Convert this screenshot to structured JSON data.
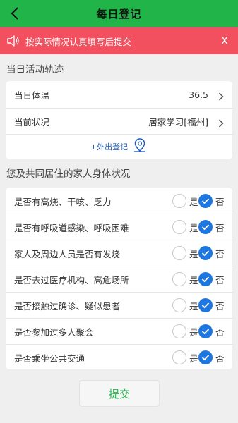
{
  "header": {
    "title": "每日登记"
  },
  "notice": {
    "text": "按实际情况认真填写后提交",
    "close": "X"
  },
  "activity": {
    "section_title": "当日活动轨迹",
    "temperature": {
      "label": "当日体温",
      "value": "36.5"
    },
    "status": {
      "label": "当前状况",
      "value": "居家学习[福州]"
    },
    "out_register": "+外出登记"
  },
  "health": {
    "section_title": "您及共同居住的家人身体状况",
    "yes_label": "是",
    "no_label": "否",
    "questions": [
      {
        "text": "是否有高烧、干咳、乏力",
        "answer": "否"
      },
      {
        "text": "是否有呼吸道感染、呼吸困难",
        "answer": "否"
      },
      {
        "text": "家人及周边人员是否有发烧",
        "answer": "否"
      },
      {
        "text": "是否去过医疗机构、高危场所",
        "answer": "否"
      },
      {
        "text": "是否接触过确诊、疑似患者",
        "answer": "否"
      },
      {
        "text": "是否参加过多人聚会",
        "answer": "否"
      },
      {
        "text": "是否乘坐公共交通",
        "answer": "否"
      }
    ]
  },
  "submit_label": "提交",
  "colors": {
    "header": "#20b449",
    "notice": "#f2505e",
    "accent": "#1e77e0",
    "link": "#1e5bb8"
  }
}
